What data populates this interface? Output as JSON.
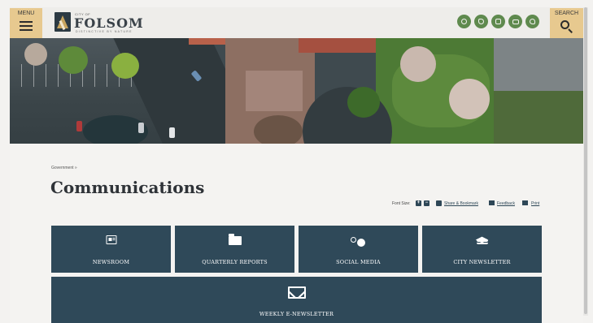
{
  "header": {
    "menu_label": "MENU",
    "search_label": "SEARCH",
    "logo": {
      "city_of": "CITY OF",
      "name": "FOLSOM",
      "tagline": "DISTINCTIVE BY NATURE"
    },
    "social": [
      {
        "icon": "facebook-icon"
      },
      {
        "icon": "twitter-icon"
      },
      {
        "icon": "instagram-icon"
      },
      {
        "icon": "youtube-icon"
      },
      {
        "icon": "flickr-icon"
      }
    ],
    "accent_color": "#e7c98f",
    "social_color": "#5f8a4e"
  },
  "breadcrumb": "Government »",
  "page_title": "Communications",
  "tools": {
    "font_size_label": "Font Size:",
    "plus": "+",
    "minus": "−",
    "share_label": "Share & Bookmark",
    "feedback_label": "Feedback",
    "print_label": "Print"
  },
  "tiles": [
    {
      "label": "NEWSROOM",
      "icon": "newspaper-icon"
    },
    {
      "label": "QUARTERLY REPORTS",
      "icon": "folder-icon"
    },
    {
      "label": "SOCIAL MEDIA",
      "icon": "social-media-icon"
    },
    {
      "label": "CITY NEWSLETTER",
      "icon": "layers-icon"
    },
    {
      "label": "WEEKLY E-NEWSLETTER",
      "icon": "envelope-icon"
    }
  ],
  "tile_color": "#2f4959"
}
